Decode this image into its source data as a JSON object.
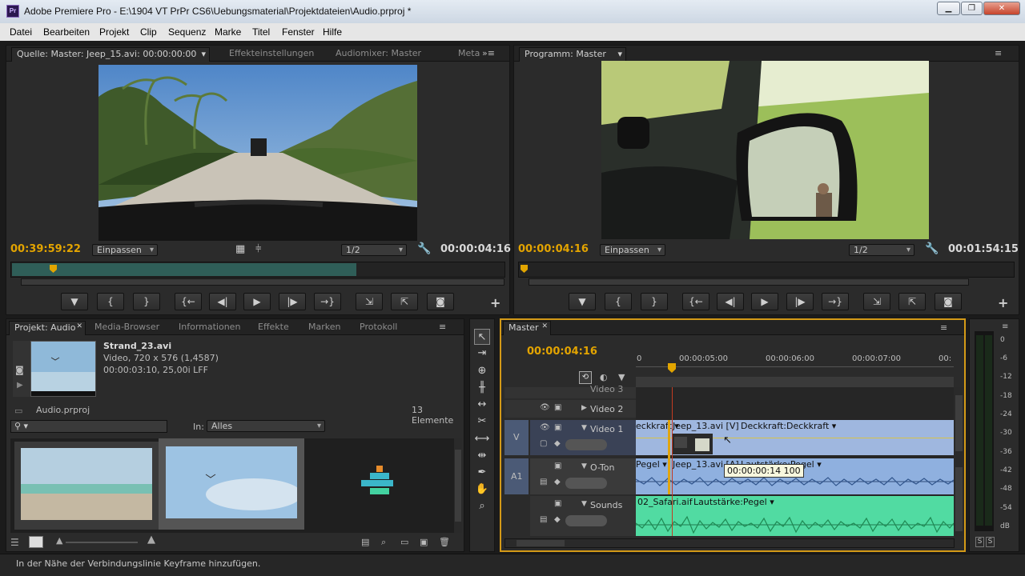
{
  "window": {
    "title": "Adobe Premiere Pro - E:\\1904 VT PrPr CS6\\Uebungsmaterial\\Projektdateien\\Audio.prproj *",
    "app_icon": "Pr",
    "min": "▁",
    "max": "❐",
    "close": "✕"
  },
  "menu": [
    "Datei",
    "Bearbeiten",
    "Projekt",
    "Clip",
    "Sequenz",
    "Marke",
    "Titel",
    "Fenster",
    "Hilfe"
  ],
  "source": {
    "tabs": [
      "Quelle: Master: Jeep_15.avi: 00:00:00:00",
      "Effekteinstellungen",
      "Audiomixer: Master",
      "Meta"
    ],
    "timecode": "00:39:59:22",
    "fit": "Einpassen",
    "resolution": "1/2",
    "duration": "00:00:04:16",
    "transport": [
      "▼",
      "{",
      "}",
      "{←",
      "◀|",
      "▶",
      "|▶",
      "→}",
      "⇲",
      "⇱",
      "◙"
    ],
    "add": "+"
  },
  "program": {
    "tab": "Programm: Master",
    "timecode": "00:00:04:16",
    "fit": "Einpassen",
    "resolution": "1/2",
    "duration": "00:01:54:15",
    "transport": [
      "▼",
      "{",
      "}",
      "{←",
      "◀|",
      "▶",
      "|▶",
      "→}",
      "⇲",
      "⇱",
      "◙"
    ],
    "add": "+"
  },
  "project": {
    "tabs": [
      "Projekt: Audio",
      "Media-Browser",
      "Informationen",
      "Effekte",
      "Marken",
      "Protokoll"
    ],
    "clip_name": "Strand_23.avi",
    "clip_info1": "Video, 720 x 576 (1,4587)",
    "clip_info2": "00:00:03:10, 25,00i LFF",
    "project_file": "Audio.prproj",
    "count": "13 Elemente",
    "search_icon": "⚲",
    "in_label": "In:",
    "in_value": "Alles"
  },
  "sequence": {
    "tab": "Master",
    "timecode": "00:00:04:16",
    "ruler": [
      "0",
      "00:00:05:00",
      "00:00:06:00",
      "00:00:07:00",
      "00:"
    ],
    "tracks": {
      "video3": "Video 3",
      "video1": "Video 1",
      "oton": "O-Ton",
      "sounds": "Sounds",
      "v_label": "V",
      "a1_label": "A1"
    },
    "clips": {
      "v1_left": "eckkraft ▾",
      "v1_main": "Jeep_13.avi [V]",
      "v1_fx": "Deckkraft:Deckkraft ▾",
      "a1_left": "Pegel ▾",
      "a1_main": "Jeep_13.avi [A]",
      "a1_fx": "Lautstärke:Pegel ▾",
      "a2_main": "02_Safari.aif",
      "a2_fx": "Lautstärke:Pegel ▾"
    },
    "tooltip": "00:00:00:14  100"
  },
  "meter": {
    "labels": [
      "0",
      "-6",
      "-12",
      "-18",
      "-24",
      "-30",
      "-36",
      "-42",
      "-48",
      "-54",
      "dB"
    ],
    "solo": "S"
  },
  "status": "In der Nähe der Verbindungslinie Keyframe hinzufügen."
}
